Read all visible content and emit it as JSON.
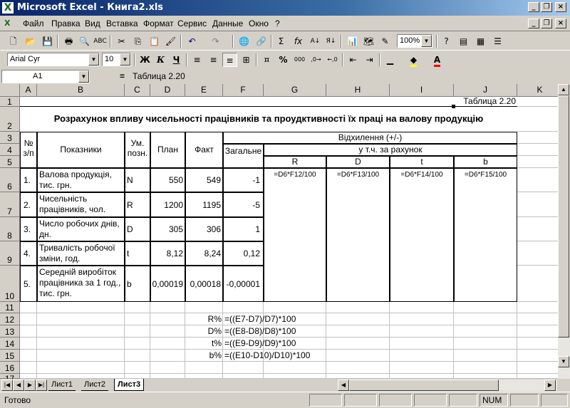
{
  "window": {
    "title": "Microsoft Excel - Книга2.xls"
  },
  "menu": [
    "Файл",
    "Правка",
    "Вид",
    "Вставка",
    "Формат",
    "Сервис",
    "Данные",
    "Окно",
    "?"
  ],
  "toolbar": {
    "zoom": "100%",
    "font": "Arial Cyr",
    "size": "10",
    "bold": "Ж",
    "italic": "К",
    "underline": "Ч",
    "percent": "%"
  },
  "formula": {
    "namebox": "A1",
    "eq": "=",
    "content": "Таблица 2.20"
  },
  "columns": [
    "A",
    "B",
    "C",
    "D",
    "E",
    "F",
    "G",
    "H",
    "I",
    "J",
    "K"
  ],
  "rows": [
    "1",
    "2",
    "3",
    "4",
    "5",
    "6",
    "7",
    "8",
    "9",
    "10",
    "11",
    "12",
    "13",
    "14",
    "15",
    "16",
    "17"
  ],
  "sheet": {
    "table_caption": "Таблица 2.20",
    "heading": "Розрахунок впливу чисельності працівників та проудктивності їх праці на валову продукцію",
    "h_no": "№ з/п",
    "h_ind": "Показники",
    "h_unit": "Ум. позн.",
    "h_plan": "План",
    "h_fact": "Факт",
    "h_dev": "Відхилення (+/-)",
    "h_incl": "у т.ч. за рахунок",
    "h_total": "Загальне",
    "h_R": "R",
    "h_D": "D",
    "h_t": "t",
    "h_b": "b",
    "rows": [
      {
        "no": "1.",
        "name": "Валова продукція, тис. грн.",
        "unit": "N",
        "plan": "550",
        "fact": "549",
        "dev": "-1"
      },
      {
        "no": "2.",
        "name": "Чисельність працівників, чол.",
        "unit": "R",
        "plan": "1200",
        "fact": "1195",
        "dev": "-5"
      },
      {
        "no": "3.",
        "name": "Число робочих днів, дн.",
        "unit": "D",
        "plan": "305",
        "fact": "306",
        "dev": "1"
      },
      {
        "no": "4.",
        "name": "Тривалість робочої зміни, год.",
        "unit": "t",
        "plan": "8,12",
        "fact": "8,24",
        "dev": "0,12"
      },
      {
        "no": "5.",
        "name": "Середній виробіток працівника за 1 год., тис. грн.",
        "unit": "b",
        "plan": "0,00019",
        "fact": "0,00018",
        "dev": "-0,00001"
      }
    ],
    "f6": [
      "=D6*F12/100",
      "=D6*F13/100",
      "=D6*F14/100",
      "=D6*F15/100"
    ],
    "pct": [
      {
        "label": "R%",
        "formula": "=((E7-D7)/D7)*100"
      },
      {
        "label": "D%",
        "formula": "=((E8-D8)/D8)*100"
      },
      {
        "label": "t%",
        "formula": "=((E9-D9)/D9)*100"
      },
      {
        "label": "b%",
        "formula": "=((E10-D10)/D10)*100"
      }
    ]
  },
  "tabs": [
    "Лист1",
    "Лист2",
    "Лист3"
  ],
  "status": {
    "ready": "Готово",
    "num": "NUM"
  }
}
